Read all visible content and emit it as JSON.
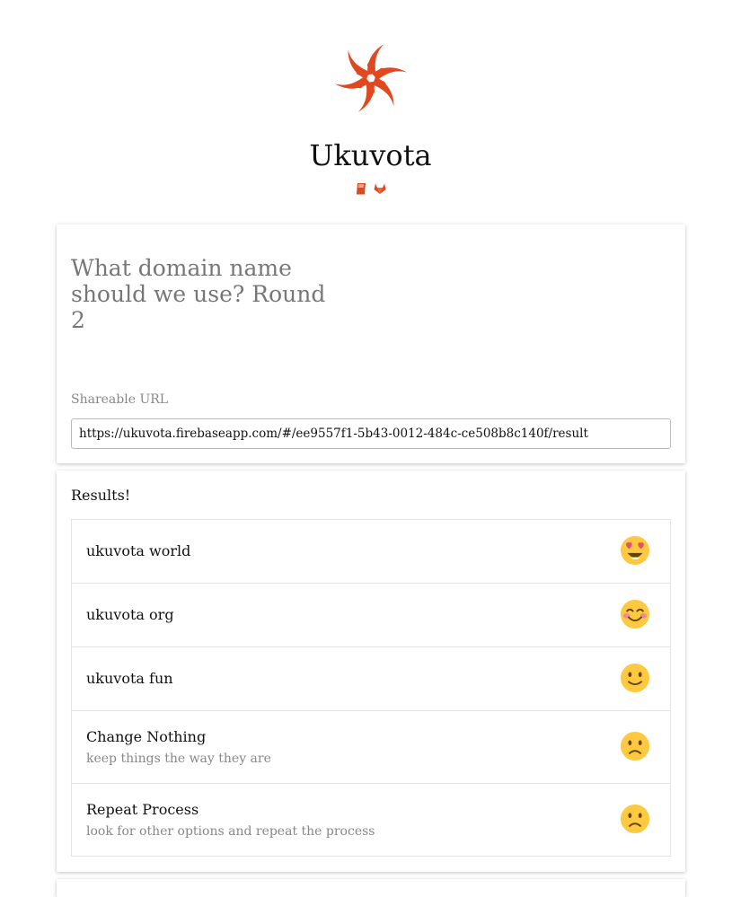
{
  "app": {
    "title": "Ukuvota"
  },
  "header_icons": [
    "book-icon",
    "gitlab-icon"
  ],
  "poll": {
    "question": "What domain name should we use? Round 2",
    "share_label": "Shareable URL",
    "share_url": "https://ukuvota.firebaseapp.com/#/ee9557f1-5b43-0012-484c-ce508b8c140f/result"
  },
  "results": {
    "heading": "Results!",
    "items": [
      {
        "name": "ukuvota world",
        "description": "",
        "emoji": "heart-eyes-emoji"
      },
      {
        "name": "ukuvota org",
        "description": "",
        "emoji": "blushing-smile-emoji"
      },
      {
        "name": "ukuvota fun",
        "description": "",
        "emoji": "slight-smile-emoji"
      },
      {
        "name": "Change Nothing",
        "description": "keep things the way they are",
        "emoji": "slight-frown-emoji"
      },
      {
        "name": "Repeat Process",
        "description": "look for other options and repeat the process",
        "emoji": "slight-frown-emoji"
      }
    ]
  },
  "colors": {
    "brand": "#e2481f",
    "emoji_face": "#fcc940",
    "heart": "#e3506d"
  }
}
